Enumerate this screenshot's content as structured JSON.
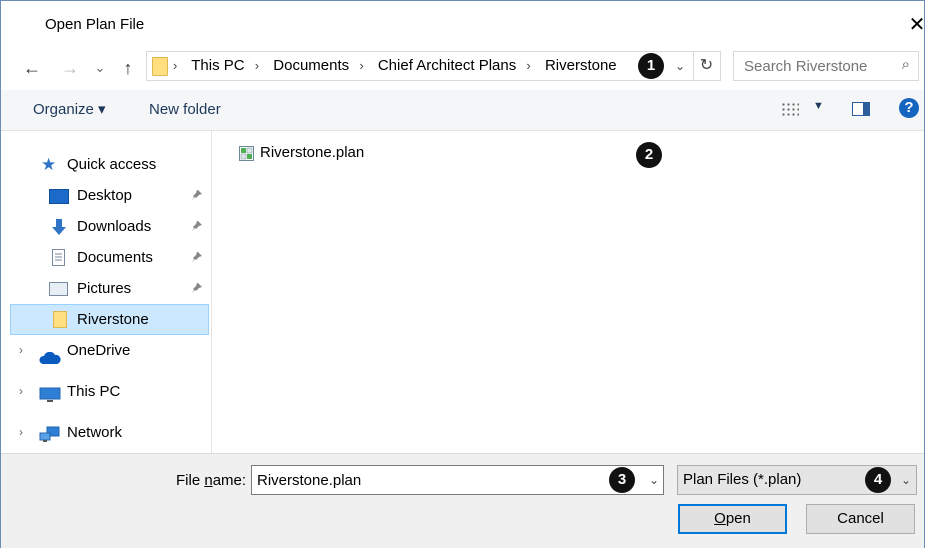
{
  "window": {
    "title": "Open Plan File",
    "close_glyph": "✕"
  },
  "nav": {
    "back": "←",
    "forward": "→",
    "recent": "⌄",
    "up": "↑"
  },
  "address": {
    "crumbs": [
      "This PC",
      "Documents",
      "Chief Architect Plans",
      "Riverstone"
    ],
    "separator": "›",
    "dropdown": "⌄",
    "refresh": "↻"
  },
  "search": {
    "placeholder": "Search Riverstone",
    "icon": "⌕"
  },
  "toolbar": {
    "organize": "Organize ▾",
    "new_folder": "New folder",
    "view_drop": "▼",
    "help": "?"
  },
  "sidebar": {
    "quick_access": "Quick access",
    "items": [
      {
        "label": "Desktop"
      },
      {
        "label": "Downloads"
      },
      {
        "label": "Documents"
      },
      {
        "label": "Pictures"
      },
      {
        "label": "Riverstone"
      }
    ],
    "pin_glyph": "📌",
    "onedrive": "OneDrive",
    "this_pc": "This PC",
    "network": "Network",
    "chevron": "›"
  },
  "files": [
    {
      "name": "Riverstone.plan"
    }
  ],
  "bottom": {
    "file_name_label_prefix": "File ",
    "file_name_label_underlined": "n",
    "file_name_label_suffix": "ame:",
    "file_name_value": "Riverstone.plan",
    "dropdown": "⌄",
    "filter": "Plan Files (*.plan)",
    "open_underlined": "O",
    "open_rest": "pen",
    "cancel": "Cancel"
  },
  "callouts": [
    "1",
    "2",
    "3",
    "4"
  ],
  "colors": {
    "accent": "#0078d7",
    "selection": "#cce8ff",
    "folder": "#ffdf80",
    "badge": "#111111"
  }
}
